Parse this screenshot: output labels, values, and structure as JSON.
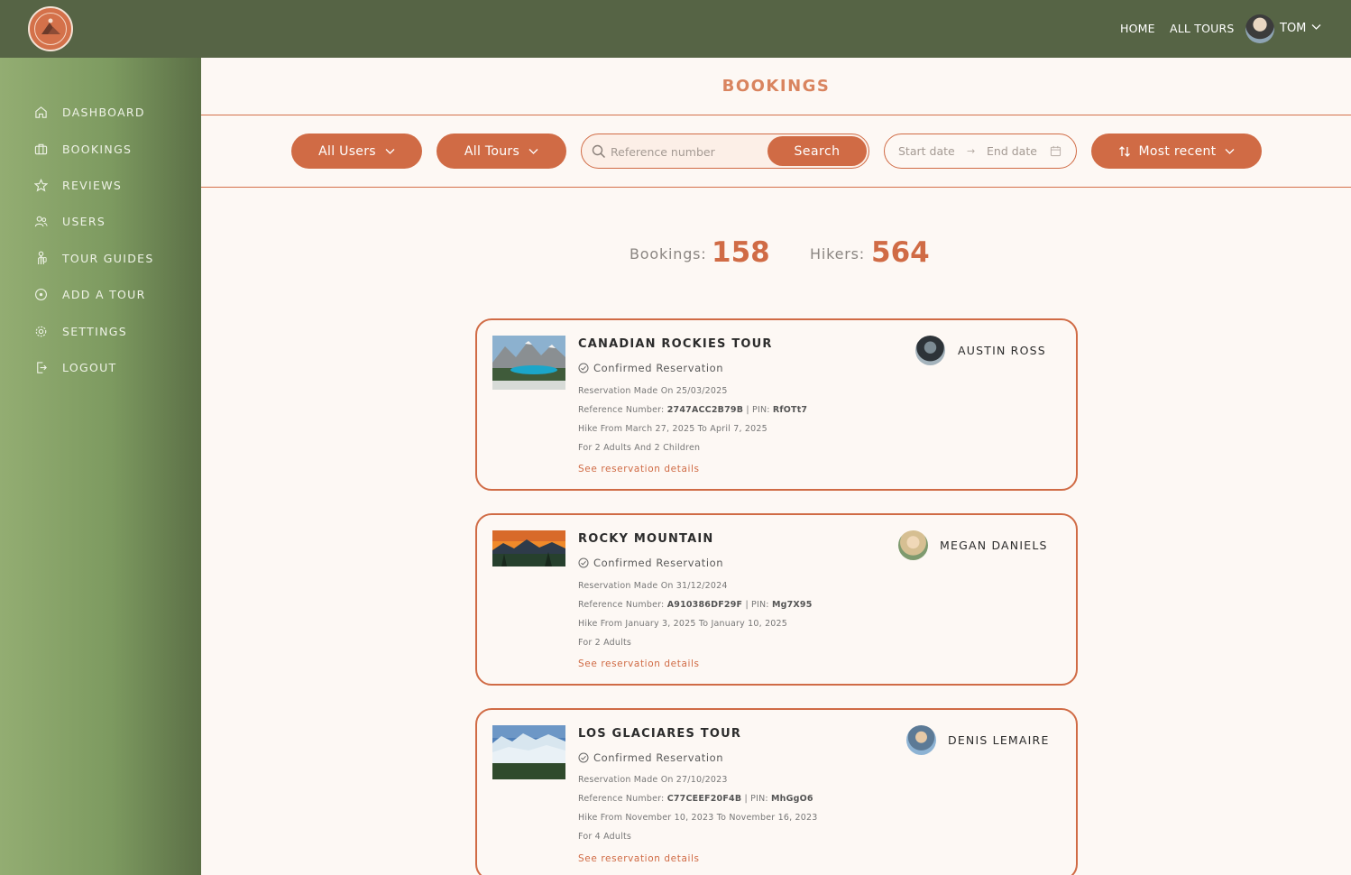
{
  "topbar": {
    "nav": [
      {
        "label": "HOME"
      },
      {
        "label": "ALL TOURS"
      }
    ],
    "user": {
      "name": "TOM"
    }
  },
  "sidebar": {
    "items": [
      {
        "label": "DASHBOARD",
        "icon": "home-icon"
      },
      {
        "label": "BOOKINGS",
        "icon": "briefcase-icon"
      },
      {
        "label": "REVIEWS",
        "icon": "star-icon"
      },
      {
        "label": "USERS",
        "icon": "users-icon"
      },
      {
        "label": "TOUR GUIDES",
        "icon": "guide-icon"
      },
      {
        "label": "ADD A TOUR",
        "icon": "add-circle-icon"
      },
      {
        "label": "SETTINGS",
        "icon": "gear-icon"
      },
      {
        "label": "LOGOUT",
        "icon": "logout-icon"
      }
    ]
  },
  "page": {
    "title": "BOOKINGS"
  },
  "filters": {
    "users_label": "All Users",
    "tours_label": "All Tours",
    "search_placeholder": "Reference number",
    "search_button": "Search",
    "start_placeholder": "Start date",
    "end_placeholder": "End date",
    "sort_label": "Most recent"
  },
  "stats": {
    "bookings_label": "Bookings:",
    "bookings_value": "158",
    "hikers_label": "Hikers:",
    "hikers_value": "564"
  },
  "bookings": [
    {
      "tour": "CANADIAN ROCKIES TOUR",
      "status": "Confirmed Reservation",
      "made_on": "Reservation Made On 25/03/2025",
      "ref_label": "Reference Number:",
      "ref": "2747ACC2B79B",
      "pin_label": "| PIN:",
      "pin": "RfOTt7",
      "dates": "Hike From March 27, 2025 To April 7, 2025",
      "party": "For 2 Adults And 2 Children",
      "link": "See reservation details",
      "user": "AUSTIN ROSS"
    },
    {
      "tour": "ROCKY MOUNTAIN",
      "status": "Confirmed Reservation",
      "made_on": "Reservation Made On 31/12/2024",
      "ref_label": "Reference Number:",
      "ref": "A910386DF29F",
      "pin_label": "| PIN:",
      "pin": "Mg7X95",
      "dates": "Hike From January 3, 2025 To January 10, 2025",
      "party": "For 2 Adults",
      "link": "See reservation details",
      "user": "MEGAN DANIELS"
    },
    {
      "tour": "LOS GLACIARES TOUR",
      "status": "Confirmed Reservation",
      "made_on": "Reservation Made On 27/10/2023",
      "ref_label": "Reference Number:",
      "ref": "C77CEEF20F4B",
      "pin_label": "| PIN:",
      "pin": "MhGgO6",
      "dates": "Hike From November 10, 2023 To November 16, 2023",
      "party": "For 4 Adults",
      "link": "See reservation details",
      "user": "DENIS LEMAIRE"
    }
  ],
  "colors": {
    "accent": "#d06b45",
    "topbar": "#566445",
    "sidebar": "#7d9a60",
    "background": "#fdf8f4"
  }
}
